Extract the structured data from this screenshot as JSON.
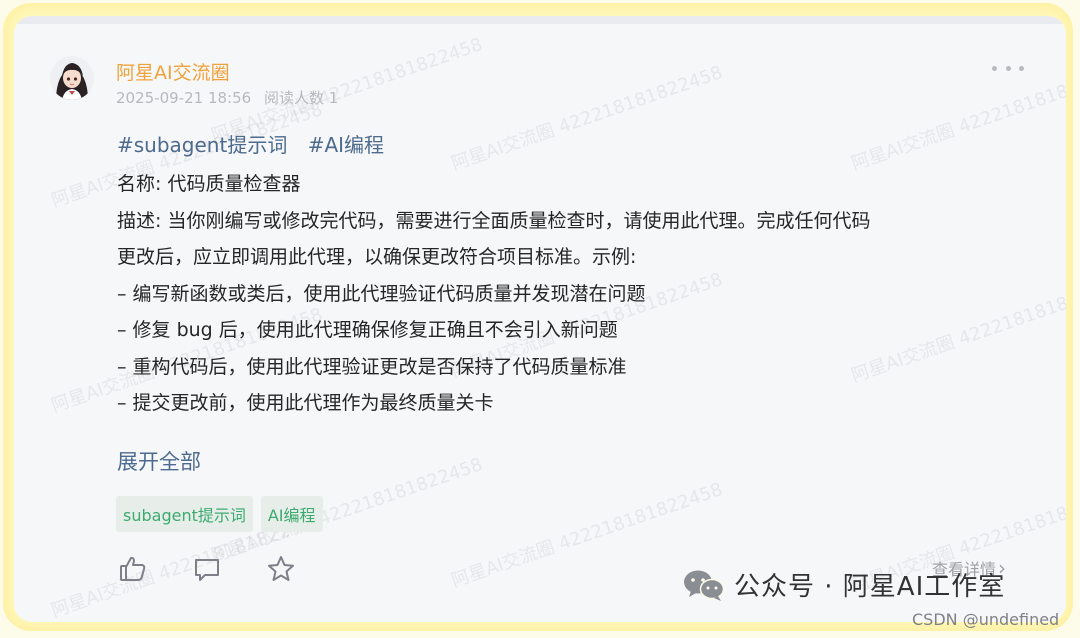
{
  "post": {
    "author": "阿星AI交流圈",
    "date": "2025-09-21 18:56",
    "read_count": "阅读人数 1",
    "hashtags": [
      "#subagent提示词",
      "#AI编程"
    ],
    "lines": [
      "名称: 代码质量检查器",
      "描述: 当你刚编写或修改完代码，需要进行全面质量检查时，请使用此代理。完成任何代码",
      "更改后，应立即调用此代理，以确保更改符合项目标准。示例:",
      "– 编写新函数或类后，使用此代理验证代码质量并发现潜在问题",
      "– 修复 bug 后，使用此代理确保修复正确且不会引入新问题",
      "– 重构代码后，使用此代理验证更改是否保持了代码质量标准",
      "– 提交更改前，使用此代理作为最终质量关卡"
    ],
    "expand_label": "展开全部",
    "tags": [
      "subagent提示词",
      "AI编程"
    ],
    "details_label": "查看详情",
    "details_chevron": "›"
  },
  "watermark": {
    "texts": [
      "阿星AI交流圈 422218181822458"
    ]
  },
  "branding": {
    "wechat_label": "公众号 · 阿星AI工作室",
    "csdn_label": "CSDN @undefined"
  },
  "icons": {
    "more": "more-horizontal-icon",
    "like": "thumbs-up-icon",
    "comment": "comment-bubble-icon",
    "favorite": "star-icon",
    "wechat": "wechat-logo-icon"
  },
  "colors": {
    "author": "#f0a23a",
    "link": "#4d6a8f",
    "tag_text": "#3daa6f",
    "tag_bg": "#e7eee9",
    "meta": "#b7b9bf"
  }
}
